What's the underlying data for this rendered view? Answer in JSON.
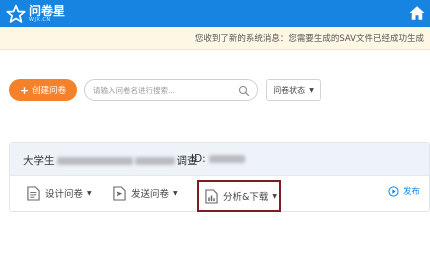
{
  "header": {
    "brand_name": "问卷星",
    "brand_sub": "WJX.CN",
    "logo_icon": "star-icon",
    "home_icon": "home-icon"
  },
  "notice": {
    "text": "您收到了新的系统消息：您需要生成的SAV文件已经成功生成"
  },
  "toolbar": {
    "create_label": "创建问卷",
    "search_placeholder": "请输入问卷名进行搜索...",
    "status_label": "问卷状态"
  },
  "survey": {
    "title_prefix": "大学生",
    "title_suffix": "调查",
    "id_label": "ID:",
    "actions": {
      "design": "设计问卷",
      "send": "发送问卷",
      "analyze": "分析&下载",
      "publish": "发布"
    }
  },
  "colors": {
    "brand_blue": "#1684e0",
    "create_orange": "#f5822a",
    "highlight_border": "#7a1e22",
    "notice_bg": "#fdf7e4"
  }
}
